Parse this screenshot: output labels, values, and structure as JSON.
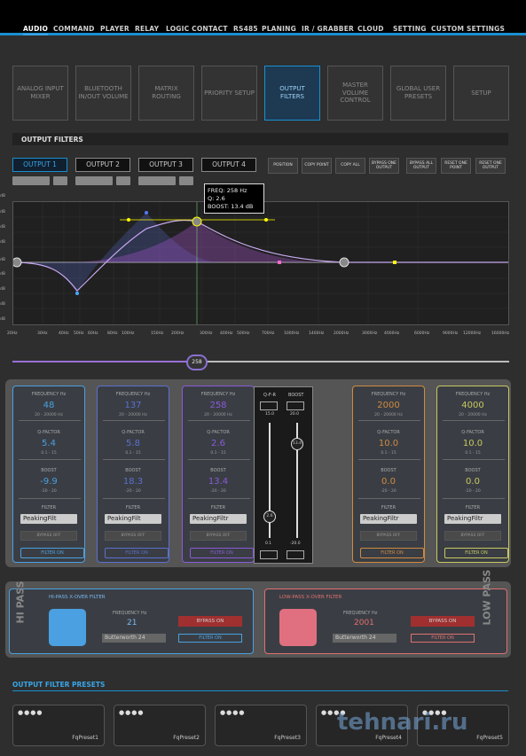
{
  "nav": [
    "AUDIO",
    "COMMAND",
    "PLAYER",
    "RELAY",
    "LOGIC CONTACT",
    "RS485",
    "PLANING",
    "IR / GRABBER",
    "CLOUD",
    "SETTING",
    "CUSTOM SETTINGS"
  ],
  "modules": [
    "ANALOG INPUT MIXER",
    "BLUETOOTH IN/OUT VOLUME",
    "MATRIX ROUTING",
    "PRIORITY SETUP",
    "OUTPUT FILTERS",
    "MASTER VOLUME CONTROL",
    "GLOBAL USER PRESETS",
    "SETUP"
  ],
  "section_title": "OUTPUT FILTERS",
  "outputs": [
    "OUTPUT 1",
    "OUTPUT 2",
    "OUTPUT 3",
    "OUTPUT 4"
  ],
  "actions": [
    "POSITION",
    "COPY POINT",
    "COPY ALL",
    "BYPASS ONE OUTPUT",
    "BYPASS ALL OUTPUT",
    "RESET ONE POINT",
    "RESET ONE OUTPUT"
  ],
  "tooltip": {
    "freq": "FREQ: 258 Hz",
    "q": "Q: 2.6",
    "boost": "BOOST: 13.4 dB"
  },
  "db_labels": [
    "dB",
    "dB",
    "dB",
    "dB",
    "dB",
    "dB",
    "dB",
    "dB",
    "dB"
  ],
  "freq_labels": [
    "20Hz",
    "30Hz",
    "40Hz",
    "50Hz",
    "60Hz",
    "80Hz",
    "100Hz",
    "150Hz",
    "200Hz",
    "300Hz",
    "400Hz",
    "500Hz",
    "700Hz",
    "1000Hz",
    "1400Hz",
    "2000Hz",
    "3000Hz",
    "4000Hz",
    "6000Hz",
    "9000Hz",
    "12000Hz",
    "16000Hz"
  ],
  "slider_value": "258",
  "band_labels": {
    "frequency": "FREQUENCY Hz",
    "frange": "20 - 20000 Hz",
    "qfactor": "Q-FACTOR",
    "qrange": "0.1 - 15",
    "boost": "BOOST",
    "brange": "-20 - 20",
    "filter": "FILTER",
    "bypass": "BYPASS OFF",
    "filteron": "FILTER ON"
  },
  "bands": [
    {
      "freq": "48",
      "q": "5.4",
      "boost": "-9.9",
      "type": "PeakingFilt",
      "color": "#4aa0e0"
    },
    {
      "freq": "137",
      "q": "5.8",
      "boost": "18.3",
      "type": "PeakingFilt",
      "color": "#5b6fd0"
    },
    {
      "freq": "258",
      "q": "2.6",
      "boost": "13.4",
      "type": "PeakingFiltr",
      "color": "#8a5ad8"
    },
    {
      "freq": "",
      "q": "",
      "boost": "",
      "type": "",
      "color": "#c050c0"
    },
    {
      "freq": "2000",
      "q": "10.0",
      "boost": "0.0",
      "type": "PeakingFiltr",
      "color": "#d08a40"
    },
    {
      "freq": "4000",
      "q": "10.0",
      "boost": "0.0",
      "type": "PeakingFiltr",
      "color": "#c8c860"
    }
  ],
  "popup": {
    "qfr": "Q-F-R",
    "boost": "BOOST",
    "qtop": "15.0",
    "btop": "20.0",
    "qval": "2.6",
    "bval": "13.4",
    "qbot": "0.1",
    "bbot": "-20.0"
  },
  "hipass": {
    "side": "HI PASS",
    "title": "HI-PASS X-OVER FILTER",
    "freq_label": "FREQUENCY Hz",
    "freq": "21",
    "type": "Butterworth 24",
    "bypass": "BYPASS ON",
    "filter": "FILTER ON"
  },
  "lowpass": {
    "side": "LOW PASS",
    "title": "LOW-PASS X-OVER FILTER",
    "freq_label": "FREQUENCY Hz",
    "freq": "2001",
    "type": "Butterworth 24",
    "bypass": "BYPASS ON",
    "filter": "FILTER ON"
  },
  "presets_title": "OUTPUT FILTER PRESETS",
  "presets": [
    "FqPreset1",
    "FqPreset2",
    "FqPreset3",
    "FqPreset4",
    "FqPreset5"
  ],
  "dots": "●●●●",
  "watermark": "tehnari.ru"
}
